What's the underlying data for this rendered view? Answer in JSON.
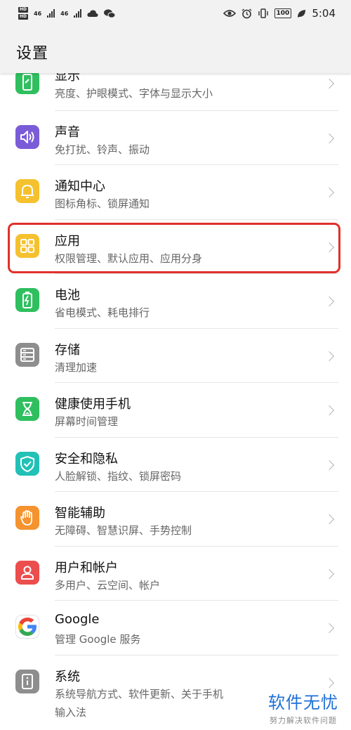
{
  "status_bar": {
    "hd1": "HD",
    "hd2": "HD",
    "net1": "46",
    "net2": "46",
    "battery": "100",
    "time": "5:04"
  },
  "header": {
    "title": "设置"
  },
  "settings": [
    {
      "title": "显示",
      "subtitle": "亮度、护眼模式、字体与显示大小",
      "icon": "display-phone-icon",
      "color": "#2fbf5f"
    },
    {
      "title": "声音",
      "subtitle": "免打扰、铃声、振动",
      "icon": "speaker-icon",
      "color": "#7a5cd8"
    },
    {
      "title": "通知中心",
      "subtitle": "图标角标、锁屏通知",
      "icon": "bell-icon",
      "color": "#f5c12e"
    },
    {
      "title": "应用",
      "subtitle": "权限管理、默认应用、应用分身",
      "icon": "apps-grid-icon",
      "color": "#f5c12e"
    },
    {
      "title": "电池",
      "subtitle": "省电模式、耗电排行",
      "icon": "battery-icon",
      "color": "#2fbf5f"
    },
    {
      "title": "存储",
      "subtitle": "清理加速",
      "icon": "storage-icon",
      "color": "#8e8e8e"
    },
    {
      "title": "健康使用手机",
      "subtitle": "屏幕时间管理",
      "icon": "hourglass-icon",
      "color": "#2fbf5f"
    },
    {
      "title": "安全和隐私",
      "subtitle": "人脸解锁、指纹、锁屏密码",
      "icon": "shield-icon",
      "color": "#22c1b6"
    },
    {
      "title": "智能辅助",
      "subtitle": "无障碍、智慧识屏、手势控制",
      "icon": "hand-icon",
      "color": "#f5932e"
    },
    {
      "title": "用户和帐户",
      "subtitle": "多用户、云空间、帐户",
      "icon": "user-icon",
      "color": "#ec4d4d"
    },
    {
      "title": "Google",
      "subtitle": "管理 Google 服务",
      "icon": "google-icon",
      "color": "#ffffff"
    },
    {
      "title": "系统",
      "subtitle": "系统导航方式、软件更新、关于手机",
      "subtitle2": "输入法",
      "icon": "system-info-icon",
      "color": "#8e8e8e"
    }
  ],
  "watermark": {
    "main": "软件无忧",
    "sub": "努力解决软件问题"
  }
}
